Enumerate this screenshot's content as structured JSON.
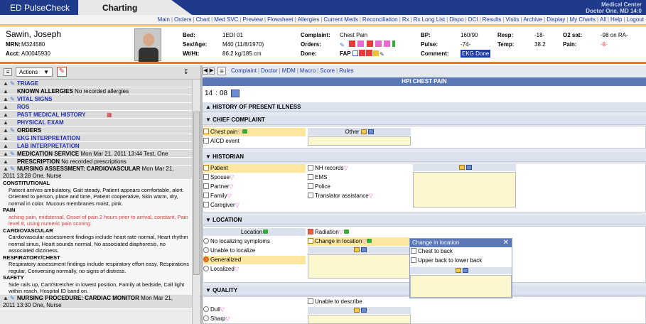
{
  "app": {
    "title": "ED PulseCheck",
    "tab": "Charting",
    "site": "Medical Center",
    "user": "Doctor One, MD",
    "time": "14:0"
  },
  "menu": [
    "Main",
    "Orders",
    "Chart",
    "Med SVC",
    "Preview",
    "Flowsheet",
    "Allergies",
    "Current Meds",
    "Reconciliation",
    "Rx",
    "Rx Long List",
    "Dispo",
    "DCI",
    "Results",
    "Visits",
    "Archive",
    "Display",
    "My Charts",
    "All",
    "Help",
    "Logout"
  ],
  "patient": {
    "name": "Sawin, Joseph",
    "mrn_label": "MRN:",
    "mrn": "M324580",
    "acct_label": "Acct:",
    "acct": "A00045930",
    "bed_label": "Bed:",
    "bed": "1EDI 01",
    "sexage_label": "Sex/Age:",
    "sexage": "M40 (11/8/1970)",
    "wtht_label": "Wt/Ht:",
    "wtht": "86.2 kg/185 cm",
    "complaint_label": "Complaint:",
    "complaint": "Chest Pain",
    "orders_label": "Orders:",
    "done_label": "Done:",
    "done": "FAP",
    "bp_label": "BP:",
    "bp": "160/90",
    "pulse_label": "Pulse:",
    "pulse": "-74-",
    "comment_label": "Comment:",
    "comment": "EKG Done",
    "resp_label": "Resp:",
    "resp": "-18-",
    "temp_label": "Temp:",
    "temp": "38.2",
    "o2_label": "O2 sat:",
    "o2": "-98 on RA-",
    "pain_label": "Pain:",
    "pain": "-8-"
  },
  "left": {
    "actions": "Actions",
    "sections": [
      {
        "label": "TRIAGE",
        "pen": true
      },
      {
        "label": "KNOWN ALLERGIES",
        "note": "No recorded allergies",
        "dark": true
      },
      {
        "label": "VITAL SIGNS",
        "pen": true
      },
      {
        "label": "ROS"
      },
      {
        "label": "PAST MEDICAL HISTORY"
      },
      {
        "label": "PHYSICAL EXAM"
      },
      {
        "label": "ORDERS",
        "pen": true,
        "dark": true
      },
      {
        "label": "EKG INTERPRETATION"
      },
      {
        "label": "LAB INTERPRETATION"
      },
      {
        "label": "MEDICATION SERVICE",
        "note": "Mon Mar 21, 2011 13:44 Test, One",
        "pen": true,
        "dark": true
      },
      {
        "label": "PRESCRIPTION",
        "note": "No recorded prescriptions",
        "dark": true
      }
    ],
    "nursing": {
      "label": "NURSING ASSESSMENT: CARDIOVASCULAR",
      "note": "Mon Mar 21,",
      "line2": "2011 13:28 One, Nurse",
      "blocks": [
        {
          "h": "CONSTITUTIONAL",
          "t": "Patient arrives ambulatory, Gait steady, Patient appears comfortable, alert. Oriented to person, place and time, Patient cooperative, Skin warm, dry, normal in color. Mucous membranes moist, pink."
        },
        {
          "h": "PAIN",
          "t": "aching pain, midsternal, Onset of pain 2 hours prior to arrival, constant, Pain level 8, using numeric pain scoring.",
          "red": true
        },
        {
          "h": "CARDIOVASCULAR",
          "t": "Cardiovascular assessment findings include heart rate normal, Heart rhythm normal sinus, Heart sounds normal, No associated diaphoresis, no associated dizziness."
        },
        {
          "h": "RESPIRATORY/CHEST",
          "t": "Respiratory assessment findings include respiratory effort easy, Respirations regular, Conversing normally, no signs of distress."
        },
        {
          "h": "SAFETY",
          "t": "Side rails up, Cart/Stretcher in lowest position, Family at bedside, Call light within reach, Hospital ID band on."
        }
      ]
    },
    "procedure": {
      "label": "NURSING PROCEDURE: CARDIAC MONITOR",
      "note": "Mon Mar 21,",
      "line2": "2011 13:30 One, Nurse"
    }
  },
  "right": {
    "links": [
      "Complaint",
      "Doctor",
      "MDM",
      "Macro",
      "Score",
      "Rules"
    ],
    "header": "HPI CHEST PAIN",
    "time_h": "14",
    "time_m": "08",
    "sections": {
      "hpi": "HISTORY OF PRESENT ILLNESS",
      "cc": "CHIEF COMPLAINT",
      "hist": "HISTORIAN",
      "loc": "LOCATION",
      "qual": "QUALITY"
    },
    "cc": {
      "chest_pain": "Chest pain",
      "aicd": "AICD event",
      "other": "Other"
    },
    "hist": {
      "col1": [
        "Patient",
        "Spouse",
        "Partner",
        "Family",
        "Caregiver"
      ],
      "col2": [
        "NH records",
        "EMS",
        "Police",
        "Translator assistance"
      ]
    },
    "loc": {
      "location": "Location",
      "radios": [
        "No localizing symptoms",
        "Unable to localize",
        "Generalized",
        "Localized"
      ],
      "radiation": "Radiation",
      "change": "Change in location"
    },
    "popup": {
      "title": "Change in location",
      "items": [
        "Chest to back",
        "Upper back to lower back"
      ]
    },
    "qual": {
      "unable": "Unable to describe",
      "items": [
        "Dull",
        "Sharp"
      ]
    }
  },
  "colors": {
    "header": "#1f3a8a",
    "accent": "#e8792a",
    "section": "#5a78b8"
  }
}
